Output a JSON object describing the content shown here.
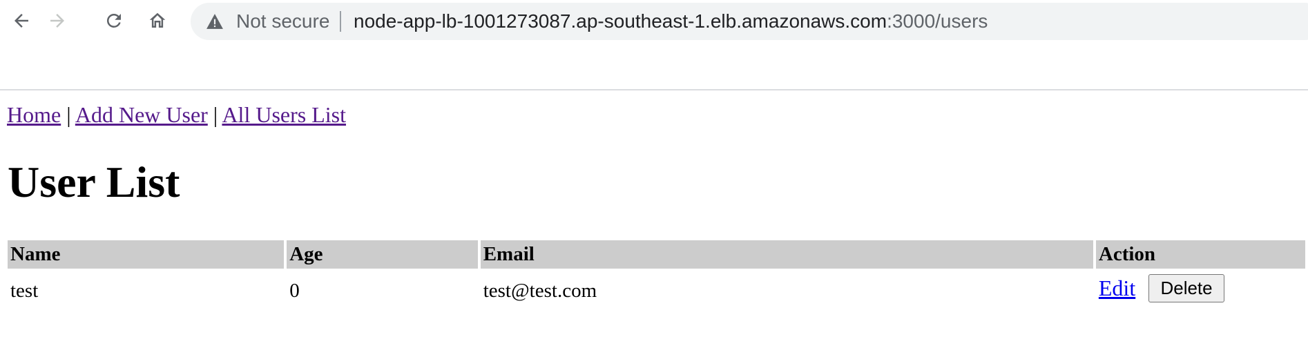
{
  "browser": {
    "security_label": "Not secure",
    "url_host": "node-app-lb-1001273087.ap-southeast-1.elb.amazonaws.com",
    "url_rest": ":3000/users",
    "icons": {
      "back": "arrow-left-icon",
      "forward": "arrow-right-icon",
      "reload": "reload-icon",
      "home": "home-icon",
      "security": "warning-triangle-icon"
    }
  },
  "nav": {
    "home": "Home",
    "add_user": "Add New User",
    "all_users": "All Users List",
    "separator": "|"
  },
  "page": {
    "title": "User List"
  },
  "table": {
    "headers": {
      "name": "Name",
      "age": "Age",
      "email": "Email",
      "action": "Action"
    },
    "rows": [
      {
        "name": "test",
        "age": "0",
        "email": "test@test.com",
        "edit_label": "Edit",
        "delete_label": "Delete"
      }
    ]
  },
  "colors": {
    "visited_link": "#551a8b",
    "link": "#0000ee",
    "header_bg": "#cccccc"
  }
}
